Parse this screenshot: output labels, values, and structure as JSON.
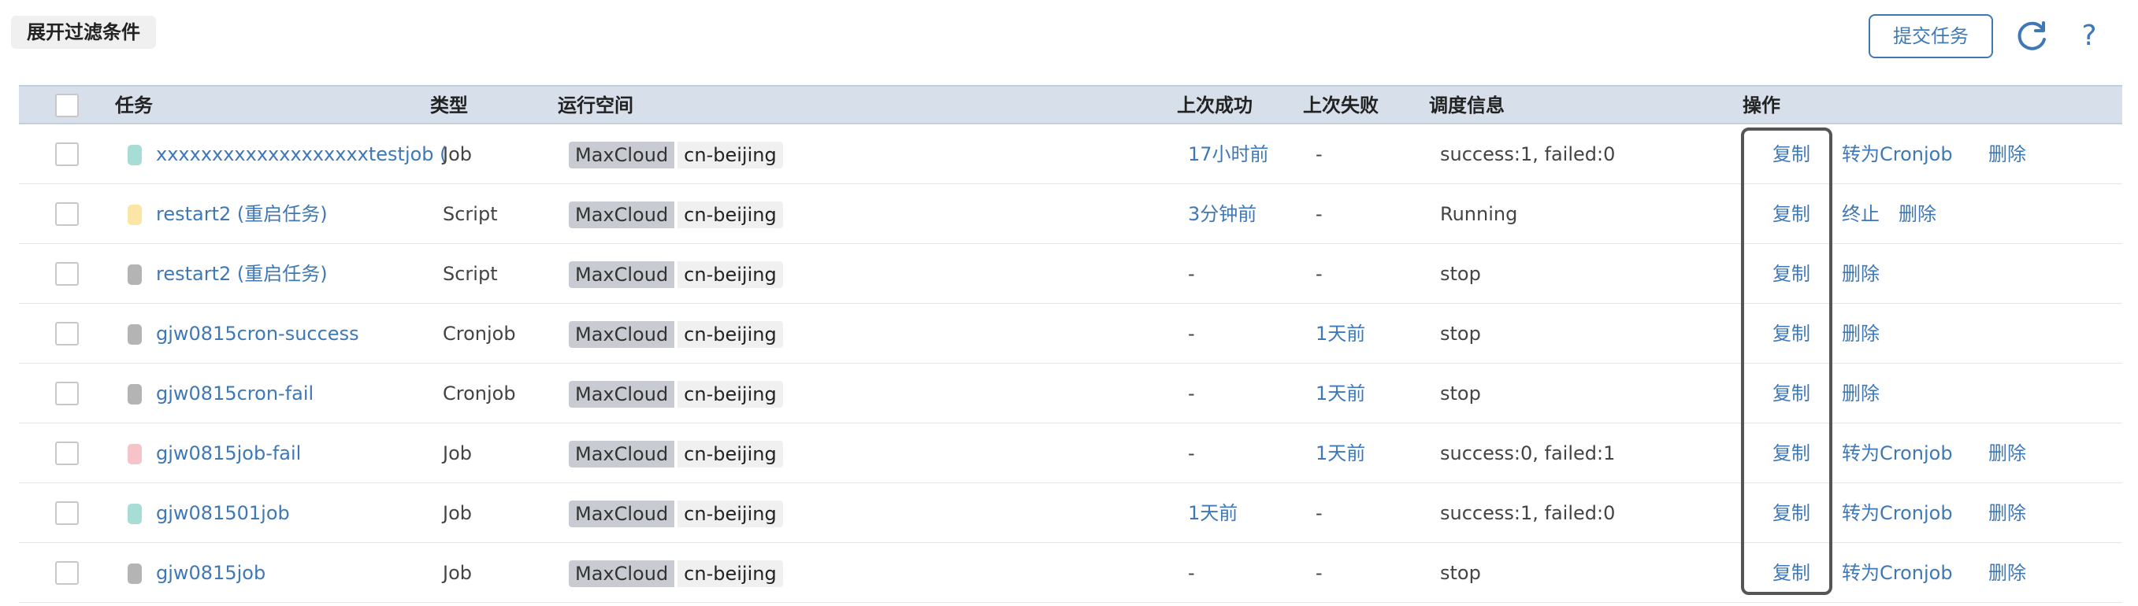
{
  "toolbar": {
    "filter_toggle_label": "展开过滤条件",
    "submit_label": "提交任务",
    "refresh_icon": "refresh-icon",
    "help_label": "?"
  },
  "table": {
    "headers": {
      "task": "任务",
      "type": "类型",
      "space": "运行空间",
      "last_success": "上次成功",
      "last_fail": "上次失败",
      "schedule": "调度信息",
      "actions": "操作"
    },
    "rows": [
      {
        "name": "xxxxxxxxxxxxxxxxxxxtestjob (一",
        "status_color": "#a8ddd5",
        "type": "Job",
        "cloud": "MaxCloud",
        "region": "cn-beijing",
        "last_success": "17小时前",
        "last_fail": "-",
        "schedule": "success:1, failed:0",
        "actions": [
          "复制",
          "转为Cronjob",
          "删除"
        ]
      },
      {
        "name": "restart2 (重启任务)",
        "status_color": "#fbe6a6",
        "type": "Script",
        "cloud": "MaxCloud",
        "region": "cn-beijing",
        "last_success": "3分钟前",
        "last_fail": "-",
        "schedule": "Running",
        "actions": [
          "复制",
          "终止",
          "删除"
        ]
      },
      {
        "name": "restart2 (重启任务)",
        "status_color": "#b4b4b4",
        "type": "Script",
        "cloud": "MaxCloud",
        "region": "cn-beijing",
        "last_success": "-",
        "last_fail": "-",
        "schedule": "stop",
        "actions": [
          "复制",
          "删除"
        ]
      },
      {
        "name": "gjw0815cron-success",
        "status_color": "#b4b4b4",
        "type": "Cronjob",
        "cloud": "MaxCloud",
        "region": "cn-beijing",
        "last_success": "-",
        "last_fail": "1天前",
        "schedule": "stop",
        "actions": [
          "复制",
          "删除"
        ]
      },
      {
        "name": "gjw0815cron-fail",
        "status_color": "#b4b4b4",
        "type": "Cronjob",
        "cloud": "MaxCloud",
        "region": "cn-beijing",
        "last_success": "-",
        "last_fail": "1天前",
        "schedule": "stop",
        "actions": [
          "复制",
          "删除"
        ]
      },
      {
        "name": "gjw0815job-fail",
        "status_color": "#f6c4c8",
        "type": "Job",
        "cloud": "MaxCloud",
        "region": "cn-beijing",
        "last_success": "-",
        "last_fail": "1天前",
        "schedule": "success:0, failed:1",
        "actions": [
          "复制",
          "转为Cronjob",
          "删除"
        ]
      },
      {
        "name": "gjw081501job",
        "status_color": "#a8ddd5",
        "type": "Job",
        "cloud": "MaxCloud",
        "region": "cn-beijing",
        "last_success": "1天前",
        "last_fail": "-",
        "schedule": "success:1, failed:0",
        "actions": [
          "复制",
          "转为Cronjob",
          "删除"
        ]
      },
      {
        "name": "gjw0815job",
        "status_color": "#b4b4b4",
        "type": "Job",
        "cloud": "MaxCloud",
        "region": "cn-beijing",
        "last_success": "-",
        "last_fail": "-",
        "schedule": "stop",
        "actions": [
          "复制",
          "转为Cronjob",
          "删除"
        ]
      }
    ]
  },
  "colors": {
    "accent": "#3f78b6",
    "header_bg": "#d7dfea"
  }
}
